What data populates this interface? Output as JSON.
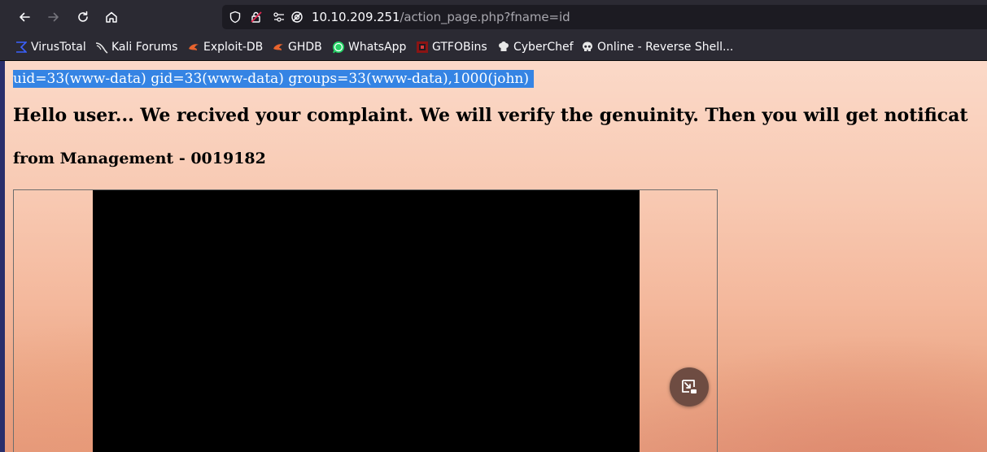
{
  "browser": {
    "url_host": "10.10.209.251",
    "url_path": "/action_page.php?fname=id"
  },
  "icons": {
    "back": "arrow-left-icon",
    "forward": "arrow-right-icon",
    "reload": "reload-icon",
    "home": "home-icon",
    "shield": "shield-icon",
    "lock": "lock-warning-icon",
    "permissions": "permissions-icon",
    "tracking": "tracking-disabled-icon",
    "pip": "picture-in-picture-icon"
  },
  "bookmarks": [
    {
      "label": "VirusTotal",
      "icon": "virustotal-icon"
    },
    {
      "label": "Kali Forums",
      "icon": "kali-dragon-icon"
    },
    {
      "label": "Exploit-DB",
      "icon": "exploitdb-icon"
    },
    {
      "label": "GHDB",
      "icon": "ghdb-icon"
    },
    {
      "label": "WhatsApp",
      "icon": "whatsapp-icon"
    },
    {
      "label": "GTFOBins",
      "icon": "gtfobins-icon"
    },
    {
      "label": "CyberChef",
      "icon": "cyberchef-icon"
    },
    {
      "label": "Online - Reverse Shell...",
      "icon": "skull-icon"
    }
  ],
  "page": {
    "command_output": "uid=33(www-data) gid=33(www-data) groups=33(www-data),1000(john)",
    "message": "Hello user... We recived your complaint. We will verify the genuinity. Then you will get notificat",
    "signature": "from Management - 0019182"
  },
  "colors": {
    "selection": "#3584e4",
    "toolbar": "#2b2a33",
    "pip_button": "#6e4c42"
  }
}
